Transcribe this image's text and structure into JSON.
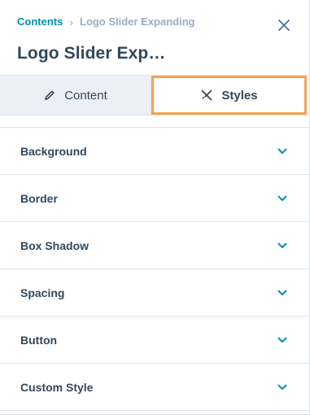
{
  "breadcrumb": {
    "parent": "Contents",
    "separator": "›",
    "current": "Logo Slider Expanding"
  },
  "header": {
    "title": "Logo Slider Exp…",
    "close_icon": "close-icon"
  },
  "tabs": [
    {
      "label": "Content",
      "icon": "pencil-icon",
      "active": false
    },
    {
      "label": "Styles",
      "icon": "styles-icon",
      "active": true
    }
  ],
  "sections": [
    {
      "label": "Background"
    },
    {
      "label": "Border"
    },
    {
      "label": "Box Shadow"
    },
    {
      "label": "Spacing"
    },
    {
      "label": "Button"
    },
    {
      "label": "Custom Style"
    }
  ],
  "colors": {
    "accent": "#0091ae",
    "highlight": "#f0a54f",
    "text": "#33475b",
    "muted": "#99acc2"
  }
}
